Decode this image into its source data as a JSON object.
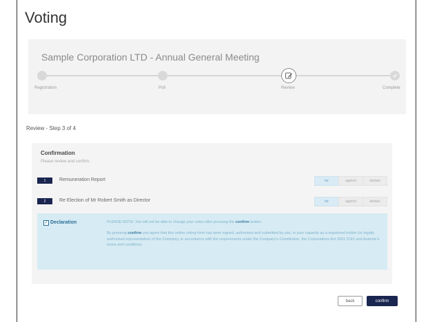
{
  "page_title": "Voting",
  "meeting_title": "Sample Corporation LTD - Annual General Meeting",
  "stepper": {
    "steps": [
      {
        "label": "Registration",
        "state": "done"
      },
      {
        "label": "Poll",
        "state": "done"
      },
      {
        "label": "Review",
        "state": "current"
      },
      {
        "label": "Complete",
        "state": "pending"
      }
    ]
  },
  "section_title": "Review - Step 3 of 4",
  "confirmation": {
    "title": "Confirmation",
    "subtitle": "Please review and confirm."
  },
  "resolutions": [
    {
      "number": "1",
      "label": "Remuneration Report",
      "votes": [
        "for",
        "against",
        "abstain"
      ],
      "selected": "for"
    },
    {
      "number": "2",
      "label": "Re Election of Mr Robert Smith as Director",
      "votes": [
        "for",
        "against",
        "abstain"
      ],
      "selected": "for"
    }
  ],
  "declaration": {
    "title": "Declaration",
    "checked": true,
    "note_prefix": "PLEASE NOTE: You will not be able to change your votes after pressing the ",
    "note_bold": "confirm",
    "note_suffix": " button.",
    "text_prefix": "By pressing ",
    "text_bold": "confirm",
    "text_suffix": " you agree that this online voting form has been signed, authorised and submitted by you, in your capacity as a registered holder (or legally authorised representative) of the Company, in accordance with the requirements under the Company's Constitution, the Corporations Act 2001 (Cth) and Automic's terms and conditions."
  },
  "buttons": {
    "back": "back",
    "confirm": "confirm"
  },
  "colors": {
    "navy": "#1a2550",
    "declaration_bg": "#d6ebf3",
    "selected_vote_bg": "#d9ebf5"
  }
}
